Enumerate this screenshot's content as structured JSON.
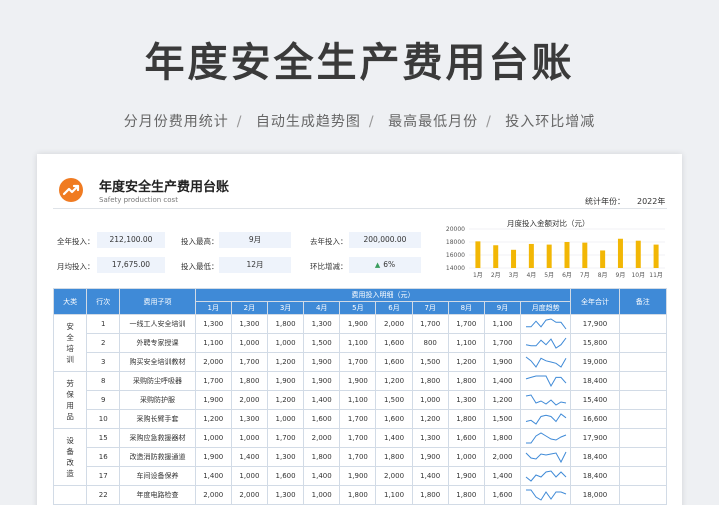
{
  "hero": {
    "title": "年度安全生产费用台账",
    "features": [
      "分月份费用统计",
      "自动生成趋势图",
      "最高最低月份",
      "投入环比增减"
    ]
  },
  "doc": {
    "title": "年度安全生产费用台账",
    "subtitle": "Safety production cost",
    "year_label": "统计年份：",
    "year_value": "2022年"
  },
  "kpis": {
    "total_label": "全年投入：",
    "total_value": "212,100.00",
    "avg_label": "月均投入：",
    "avg_value": "17,675.00",
    "max_label": "投入最高：",
    "max_value": "9月",
    "min_label": "投入最低：",
    "min_value": "12月",
    "last_label": "去年投入：",
    "last_value": "200,000.00",
    "yoy_label": "环比增减：",
    "yoy_value": "6%"
  },
  "colors": {
    "accent": "#3f8ad7",
    "bar": "#f2b705",
    "logo": "#f07b22",
    "spark": "#3f8ad7"
  },
  "chart_data": {
    "type": "bar",
    "title": "月度投入金额对比（元）",
    "categories": [
      "1月",
      "2月",
      "3月",
      "4月",
      "5月",
      "6月",
      "7月",
      "8月",
      "9月",
      "10月",
      "11月"
    ],
    "values": [
      18100,
      17500,
      16800,
      17700,
      17600,
      18000,
      17900,
      16700,
      18500,
      18200,
      17600
    ],
    "ylim": [
      14000,
      20000
    ],
    "yticks": [
      "20000",
      "18000",
      "16000",
      "14000"
    ],
    "grid": true
  },
  "table": {
    "headers": {
      "cat": "大类",
      "row": "行次",
      "item": "费用子项",
      "detail": "费用投入明细（元）",
      "trend": "月度趋势",
      "total": "全年合计",
      "note": "备注"
    },
    "months": [
      "1月",
      "2月",
      "3月",
      "4月",
      "5月",
      "6月",
      "7月",
      "8月",
      "9月"
    ],
    "groups": [
      {
        "name": "安全培训",
        "rows": [
          {
            "no": "1",
            "item": "一线工人安全培训",
            "m": [
              "1,300",
              "1,300",
              "1,800",
              "1,300",
              "1,900",
              "2,000",
              "1,700",
              "1,700",
              "1,100"
            ],
            "total": "17,900"
          },
          {
            "no": "2",
            "item": "外聘专家授课",
            "m": [
              "1,100",
              "1,000",
              "1,000",
              "1,500",
              "1,100",
              "1,600",
              "800",
              "1,100",
              "1,700"
            ],
            "total": "15,800"
          },
          {
            "no": "3",
            "item": "购买安全培训教材",
            "m": [
              "2,000",
              "1,700",
              "1,200",
              "1,900",
              "1,700",
              "1,600",
              "1,500",
              "1,200",
              "1,900"
            ],
            "total": "19,000"
          }
        ]
      },
      {
        "name": "劳保用品",
        "rows": [
          {
            "no": "8",
            "item": "采购防尘呼吸器",
            "m": [
              "1,700",
              "1,800",
              "1,900",
              "1,900",
              "1,900",
              "1,200",
              "1,800",
              "1,800",
              "1,400"
            ],
            "total": "18,400"
          },
          {
            "no": "9",
            "item": "采购防护服",
            "m": [
              "1,900",
              "2,000",
              "1,200",
              "1,400",
              "1,100",
              "1,500",
              "1,000",
              "1,300",
              "1,200"
            ],
            "total": "15,400"
          },
          {
            "no": "10",
            "item": "采购长臂手套",
            "m": [
              "1,200",
              "1,300",
              "1,000",
              "1,600",
              "1,700",
              "1,600",
              "1,200",
              "1,800",
              "1,500"
            ],
            "total": "16,600"
          }
        ]
      },
      {
        "name": "设备改造",
        "rows": [
          {
            "no": "15",
            "item": "采购应急救援器材",
            "m": [
              "1,000",
              "1,000",
              "1,700",
              "2,000",
              "1,700",
              "1,400",
              "1,300",
              "1,600",
              "1,800"
            ],
            "total": "17,900"
          },
          {
            "no": "16",
            "item": "改造消防救援通道",
            "m": [
              "1,900",
              "1,400",
              "1,300",
              "1,800",
              "1,700",
              "1,800",
              "1,900",
              "1,000",
              "2,000"
            ],
            "total": "18,400"
          },
          {
            "no": "17",
            "item": "车间设备保养",
            "m": [
              "1,400",
              "1,000",
              "1,600",
              "1,400",
              "1,900",
              "2,000",
              "1,400",
              "1,900",
              "1,400"
            ],
            "total": "18,400"
          }
        ]
      },
      {
        "name": "",
        "rows": [
          {
            "no": "22",
            "item": "年度电路检查",
            "m": [
              "2,000",
              "2,000",
              "1,300",
              "1,000",
              "1,800",
              "1,100",
              "1,800",
              "1,800",
              "1,600"
            ],
            "total": "18,000"
          }
        ]
      }
    ]
  }
}
